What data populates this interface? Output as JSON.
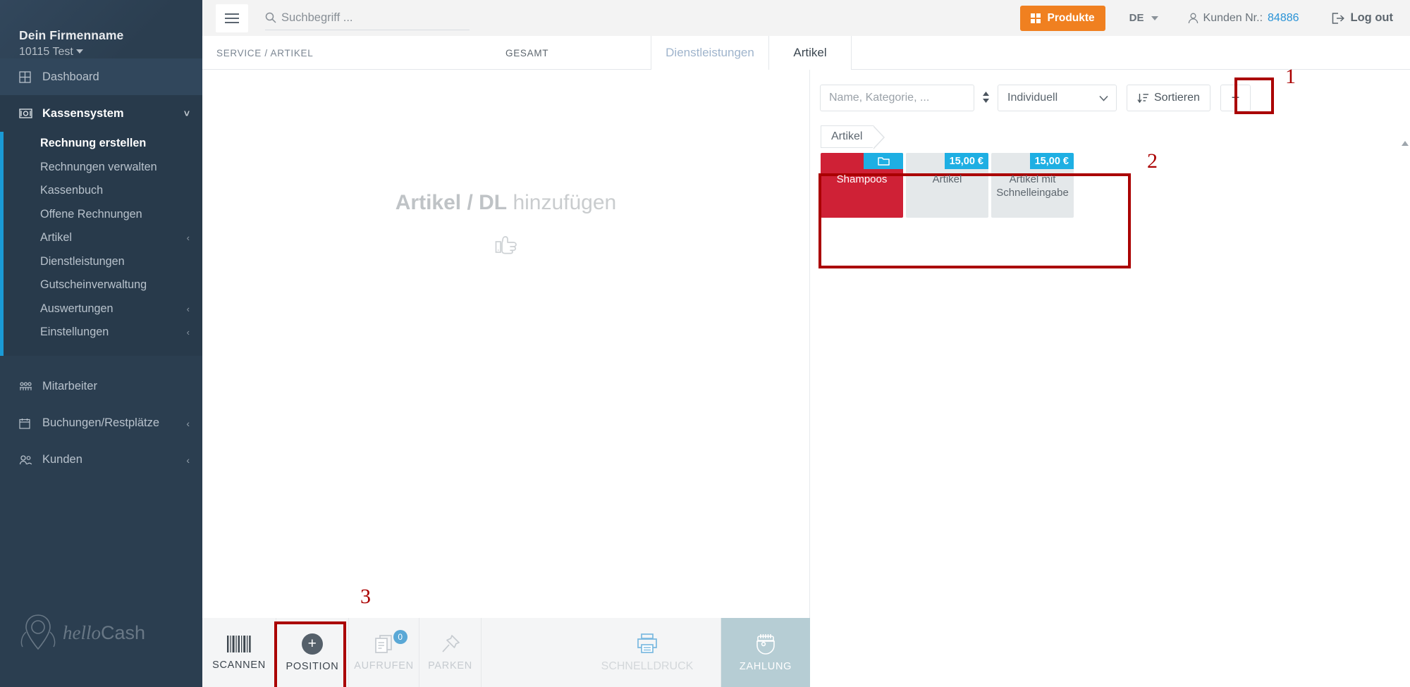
{
  "sidebar": {
    "brand_name": "Dein Firmenname",
    "brand_sub": "10115 Test",
    "dashboard": {
      "label": "Dashboard",
      "icon": "grid-icon"
    },
    "kassensystem": {
      "label": "Kassensystem",
      "icon": "cash-icon",
      "chevron": "chevron-down-icon"
    },
    "submenu": [
      {
        "label": "Rechnung erstellen",
        "selected": true
      },
      {
        "label": "Rechnungen verwalten",
        "selected": false
      },
      {
        "label": "Kassenbuch",
        "selected": false
      },
      {
        "label": "Offene Rechnungen",
        "selected": false
      },
      {
        "label": "Artikel",
        "selected": false,
        "chevron": "‹"
      },
      {
        "label": "Dienstleistungen",
        "selected": false
      },
      {
        "label": "Gutscheinverwaltung",
        "selected": false
      },
      {
        "label": "Auswertungen",
        "selected": false,
        "chevron": "‹"
      },
      {
        "label": "Einstellungen",
        "selected": false,
        "chevron": "‹"
      }
    ],
    "bottom_items": [
      {
        "label": "Mitarbeiter",
        "icon": "users-group-icon",
        "chevron": ""
      },
      {
        "label": "Buchungen/Restplätze",
        "icon": "calendar-icon",
        "chevron": "‹"
      },
      {
        "label": "Kunden",
        "icon": "customers-icon",
        "chevron": "‹"
      }
    ],
    "logo": {
      "part1": "hello",
      "part2": "Cash"
    }
  },
  "topbar": {
    "hamburger": "menu-icon",
    "search_placeholder": "Suchbegriff ...",
    "produkte_label": "Produkte",
    "language": "DE",
    "kunden_label": "Kunden Nr.:",
    "kunden_number": "84886",
    "logout_label": "Log out",
    "accent_orange": "#f08020",
    "accent_blue": "#2a93d6"
  },
  "tabsrow": {
    "col_service": "SERVICE / ARTIKEL",
    "col_gesamt": "GESAMT",
    "tab_dienstleistungen": "Dienstleistungen",
    "tab_artikel": "Artikel"
  },
  "leftpane": {
    "empty_bold": "Artikel / DL",
    "empty_rest": " hinzufügen",
    "hand_icon": "pointing-hand-icon"
  },
  "rightpane": {
    "search_placeholder": "Name, Kategorie, ...",
    "updown_icon": "sort-updown-icon",
    "select_value": "Individuell",
    "sort_label": "Sortieren",
    "sort_icon": "sort-desc-icon",
    "add_label": "+",
    "breadcrumb": "Artikel",
    "tiles": [
      {
        "name": "Shampoos",
        "type": "category",
        "badge": "",
        "badge_icon": "folder-icon",
        "color": "#cf2136"
      },
      {
        "name": "Artikel",
        "type": "product",
        "badge": "15,00 €",
        "badge_icon": "",
        "color": "#e4e8ea"
      },
      {
        "name": "Artikel mit Schnelleingabe",
        "type": "product",
        "badge": "15,00 €",
        "badge_icon": "",
        "color": "#e4e8ea"
      }
    ],
    "badge_blue": "#1eafe3"
  },
  "bottombar": {
    "buttons": [
      {
        "label": "SCANNEN",
        "icon": "barcode-icon",
        "disabled": false
      },
      {
        "label": "POSITION",
        "icon": "plus-circle-icon",
        "disabled": false
      },
      {
        "label": "AUFRUFEN",
        "icon": "documents-icon",
        "disabled": true,
        "badge": "0"
      },
      {
        "label": "PARKEN",
        "icon": "pin-icon",
        "disabled": true
      },
      {
        "label": "SCHNELLDRUCK",
        "icon": "printer-icon",
        "disabled": true
      },
      {
        "label": "ZAHLUNG",
        "icon": "cash-register-icon",
        "disabled": false
      }
    ]
  },
  "annotations": [
    {
      "number": "1",
      "target": "add-button"
    },
    {
      "number": "2",
      "target": "product-tiles"
    },
    {
      "number": "3",
      "target": "position-button"
    }
  ]
}
